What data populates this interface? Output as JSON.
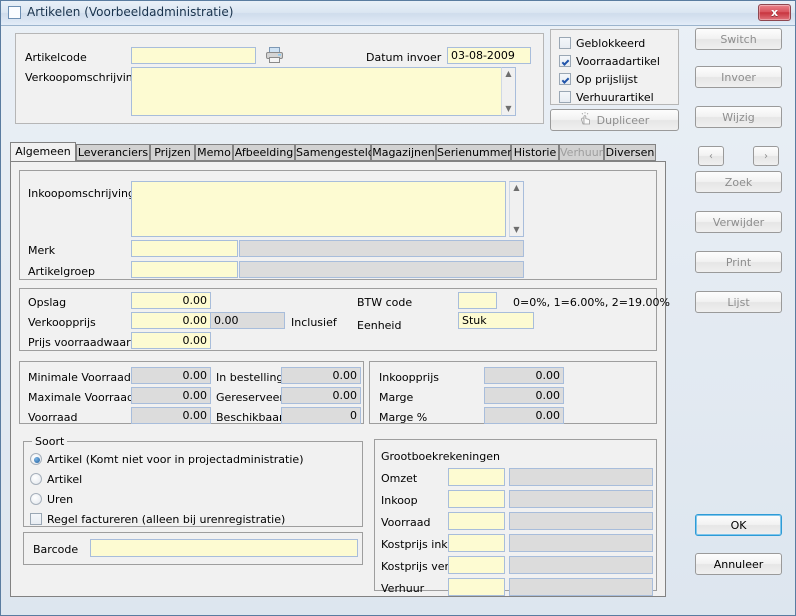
{
  "window": {
    "title": "Artikelen (Voorbeeldadministratie)",
    "close_label": "x",
    "icon": "window-icon"
  },
  "header": {
    "artikelcode_label": "Artikelcode",
    "artikelcode_value": "",
    "verkoopomschrijving_label": "Verkoopomschrijving",
    "verkoopomschrijving_value": "",
    "datum_invoer_label": "Datum invoer",
    "datum_invoer_value": "03-08-2009",
    "print_icon": "printer-icon"
  },
  "flags": {
    "items": [
      {
        "label": "Geblokkeerd",
        "checked": false
      },
      {
        "label": "Voorraadartikel",
        "checked": true
      },
      {
        "label": "Op prijslijst",
        "checked": true
      },
      {
        "label": "Verhuurartikel",
        "checked": false
      }
    ],
    "dupliceer_label": "Dupliceer",
    "dupliceer_enabled": false,
    "dupliceer_icon": "hand-click-icon"
  },
  "sidebar": {
    "buttons": [
      {
        "label": "Switch",
        "enabled": false
      },
      {
        "label": "Invoer",
        "enabled": false
      },
      {
        "label": "Wijzig",
        "enabled": false
      },
      {
        "label": "Zoek",
        "enabled": false
      },
      {
        "label": "Verwijder",
        "enabled": false
      },
      {
        "label": "Print",
        "enabled": false
      },
      {
        "label": "Lijst",
        "enabled": false
      }
    ],
    "prev_label": "‹",
    "next_label": "›",
    "ok_label": "OK",
    "cancel_label": "Annuleer"
  },
  "tabs": [
    {
      "label": "Algemeen",
      "active": true,
      "enabled": true
    },
    {
      "label": "Leveranciers",
      "active": false,
      "enabled": true
    },
    {
      "label": "Prijzen",
      "active": false,
      "enabled": true
    },
    {
      "label": "Memo",
      "active": false,
      "enabled": true
    },
    {
      "label": "Afbeelding",
      "active": false,
      "enabled": true
    },
    {
      "label": "Samengesteld",
      "active": false,
      "enabled": true
    },
    {
      "label": "Magazijnen",
      "active": false,
      "enabled": true
    },
    {
      "label": "Serienummers",
      "active": false,
      "enabled": true
    },
    {
      "label": "Historie",
      "active": false,
      "enabled": true
    },
    {
      "label": "Verhuur",
      "active": false,
      "enabled": false
    },
    {
      "label": "Diversen",
      "active": false,
      "enabled": true
    }
  ],
  "algemeen": {
    "inkoopomschrijving_label": "Inkoopomschrijving",
    "inkoopomschrijving_value": "",
    "merk_label": "Merk",
    "merk_value": "",
    "merk_desc": "",
    "artikelgroep_label": "Artikelgroep",
    "artikelgroep_value": "",
    "artikelgroep_desc": "",
    "prices": {
      "opslag_label": "Opslag",
      "opslag_value": "0.00",
      "verkoopprijs_label": "Verkoopprijs",
      "verkoopprijs_value": "0.00",
      "verkoopprijs_incl_value": "0.00",
      "inclusief_label": "Inclusief",
      "prijs_voorraadwaard_label": "Prijs voorraadwaard.",
      "prijs_voorraadwaard_value": "0.00",
      "btw_code_label": "BTW code",
      "btw_code_value": "",
      "btw_hint": "0=0%, 1=6.00%, 2=19.00%",
      "eenheid_label": "Eenheid",
      "eenheid_value": "Stuk"
    },
    "stock": {
      "minimale_voorraad_label": "Minimale Voorraad",
      "minimale_voorraad_value": "0.00",
      "maximale_voorraad_label": "Maximale Voorraad",
      "maximale_voorraad_value": "0.00",
      "voorraad_label": "Voorraad",
      "voorraad_value": "0.00",
      "in_bestelling_label": "In bestelling",
      "in_bestelling_value": "0.00",
      "gereserveerd_label": "Gereserveerd",
      "gereserveerd_value": "0.00",
      "beschikbaar_label": "Beschikbaar",
      "beschikbaar_value": "0"
    },
    "margins": {
      "inkoopprijs_label": "Inkoopprijs",
      "inkoopprijs_value": "0.00",
      "marge_label": "Marge",
      "marge_value": "0.00",
      "marge_pct_label": "Marge %",
      "marge_pct_value": "0.00"
    },
    "soort": {
      "caption": "Soort",
      "options": [
        {
          "label": "Artikel (Komt niet voor in projectadministratie)",
          "selected": true
        },
        {
          "label": "Artikel",
          "selected": false
        },
        {
          "label": "Uren",
          "selected": false
        }
      ],
      "regel_factureren_label": "Regel factureren (alleen bij urenregistratie)",
      "regel_factureren_checked": false
    },
    "barcode": {
      "label": "Barcode",
      "value": ""
    },
    "grootboek": {
      "caption": "Grootboekrekeningen",
      "rows": [
        {
          "label": "Omzet",
          "code": "",
          "desc": ""
        },
        {
          "label": "Inkoop",
          "code": "",
          "desc": ""
        },
        {
          "label": "Voorraad",
          "code": "",
          "desc": ""
        },
        {
          "label": "Kostprijs ink.",
          "code": "",
          "desc": ""
        },
        {
          "label": "Kostprijs verk.",
          "code": "",
          "desc": ""
        },
        {
          "label": "Verhuur",
          "code": "",
          "desc": ""
        }
      ]
    }
  },
  "colors": {
    "field_yellow": "#fdfbd2",
    "field_gray": "#dcdcdc",
    "field_border": "#a8bddb",
    "accent_blue": "#2e9bd6",
    "close_red": "#c8353f"
  }
}
